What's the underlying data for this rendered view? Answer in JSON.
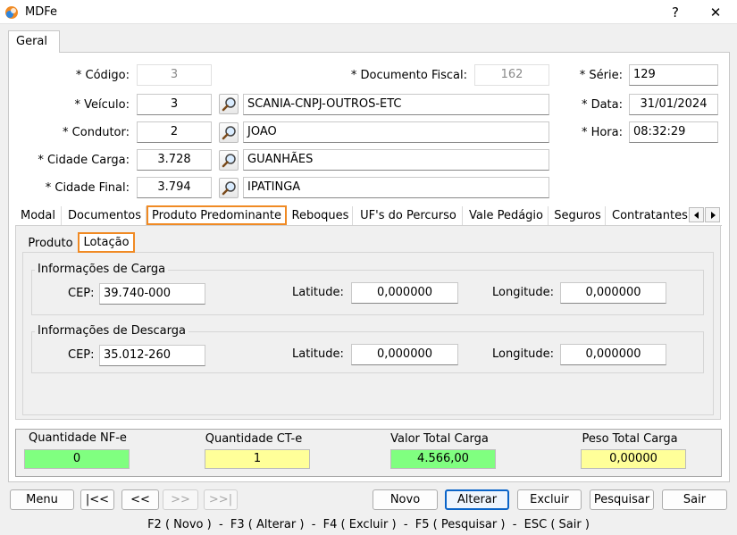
{
  "window": {
    "title": "MDFe",
    "help": "?",
    "close": "✕"
  },
  "main_tab": "Geral",
  "form": {
    "codigo_label": "* Código:",
    "codigo": "3",
    "documento_fiscal_label": "* Documento Fiscal:",
    "documento_fiscal": "162",
    "serie_label": "* Série:",
    "serie": "129",
    "veiculo_label": "* Veículo:",
    "veiculo": "3",
    "veiculo_desc": "SCANIA-CNPJ-OUTROS-ETC",
    "data_label": "* Data:",
    "data": "31/01/2024",
    "condutor_label": "* Condutor:",
    "condutor": "2",
    "condutor_desc": "JOAO",
    "hora_label": "* Hora:",
    "hora": "08:32:29",
    "cidade_carga_label": "* Cidade Carga:",
    "cidade_carga": "3.728",
    "cidade_carga_desc": "GUANHÃES",
    "cidade_final_label": "* Cidade Final:",
    "cidade_final": "3.794",
    "cidade_final_desc": "IPATINGA"
  },
  "tabs": [
    "Modal",
    "Documentos",
    "Produto Predominante",
    "Reboques",
    "UF's do Percurso",
    "Vale Pedágio",
    "Seguros",
    "Contratantes"
  ],
  "subtabs": [
    "Produto",
    "Lotação"
  ],
  "carga": {
    "title": "Informações de Carga",
    "cep_label": "CEP:",
    "cep": "39.740-000",
    "lat_label": "Latitude:",
    "lat": "0,000000",
    "lon_label": "Longitude:",
    "lon": "0,000000"
  },
  "descarga": {
    "title": "Informações de Descarga",
    "cep_label": "CEP:",
    "cep": "35.012-260",
    "lat_label": "Latitude:",
    "lat": "0,000000",
    "lon_label": "Longitude:",
    "lon": "0,000000"
  },
  "totals": {
    "nfe_label": "Quantidade NF-e",
    "nfe": "0",
    "cte_label": "Quantidade CT-e",
    "cte": "1",
    "valor_label": "Valor Total Carga",
    "valor": "4.566,00",
    "peso_label": "Peso Total Carga",
    "peso": "0,00000"
  },
  "buttons": {
    "menu": "Menu",
    "first": "|<<",
    "prev": "<<",
    "next": ">>",
    "last": ">>|",
    "novo": "Novo",
    "alterar": "Alterar",
    "excluir": "Excluir",
    "pesquisar": "Pesquisar",
    "sair": "Sair"
  },
  "shortcuts": "F2 ( Novo )  -  F3 ( Alterar )  -  F4 ( Excluir )  -  F5 ( Pesquisar )  -  ESC ( Sair )",
  "colors": {
    "green": "#80ff80",
    "yellow": "#ffff99",
    "accent": "#f08a24"
  }
}
